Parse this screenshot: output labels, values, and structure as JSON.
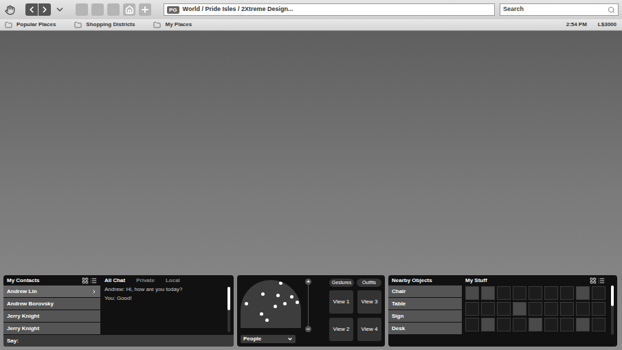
{
  "toolbar": {
    "rating": "PG",
    "address": "World / Pride Isles / 2Xtreme Design...",
    "search_placeholder": "Search"
  },
  "bookmarks": [
    {
      "label": "Popular Places"
    },
    {
      "label": "Shopping Districts"
    },
    {
      "label": "My Places"
    }
  ],
  "status": {
    "time": "2:54 PM",
    "balance": "L$3000"
  },
  "contacts": {
    "title": "My Contacts",
    "items": [
      {
        "name": "Andrew Lin",
        "selected": true
      },
      {
        "name": "Andrew Borovsky",
        "selected": false
      },
      {
        "name": "Jerry Knight",
        "selected": false
      },
      {
        "name": "Jerry Knight",
        "selected": false
      }
    ]
  },
  "chat": {
    "tabs": [
      {
        "label": "All Chat",
        "selected": true
      },
      {
        "label": "Private",
        "selected": false
      },
      {
        "label": "Local",
        "selected": false
      }
    ],
    "messages": [
      {
        "text": "Andrew: Hi, how are you today?"
      },
      {
        "text": "You: Good!"
      }
    ],
    "input_label": "Say:"
  },
  "radar": {
    "filter": "People",
    "zoom_in": "+",
    "zoom_out": "−"
  },
  "controls": {
    "top_buttons": [
      "Gestures",
      "Outfits"
    ],
    "views": [
      "View 1",
      "View 3",
      "View 2",
      "View 4"
    ]
  },
  "nearby": {
    "title": "Nearby Objects",
    "items": [
      "Chair",
      "Table",
      "Sign",
      "Desk"
    ]
  },
  "stuff": {
    "title": "My Stuff",
    "slots": [
      {
        "filled": true
      },
      {
        "filled": true
      },
      {
        "filled": false
      },
      {
        "filled": false
      },
      {
        "filled": false
      },
      {
        "filled": false
      },
      {
        "filled": false
      },
      {
        "filled": true
      },
      {
        "filled": false
      },
      {
        "filled": false
      },
      {
        "filled": false
      },
      {
        "filled": false
      },
      {
        "filled": true
      },
      {
        "filled": false
      },
      {
        "filled": false
      },
      {
        "filled": false
      },
      {
        "filled": false
      },
      {
        "filled": false
      },
      {
        "filled": false
      },
      {
        "filled": true
      },
      {
        "filled": false
      },
      {
        "filled": false
      },
      {
        "filled": true
      },
      {
        "filled": false
      },
      {
        "filled": false
      },
      {
        "filled": true
      },
      {
        "filled": false
      }
    ]
  }
}
